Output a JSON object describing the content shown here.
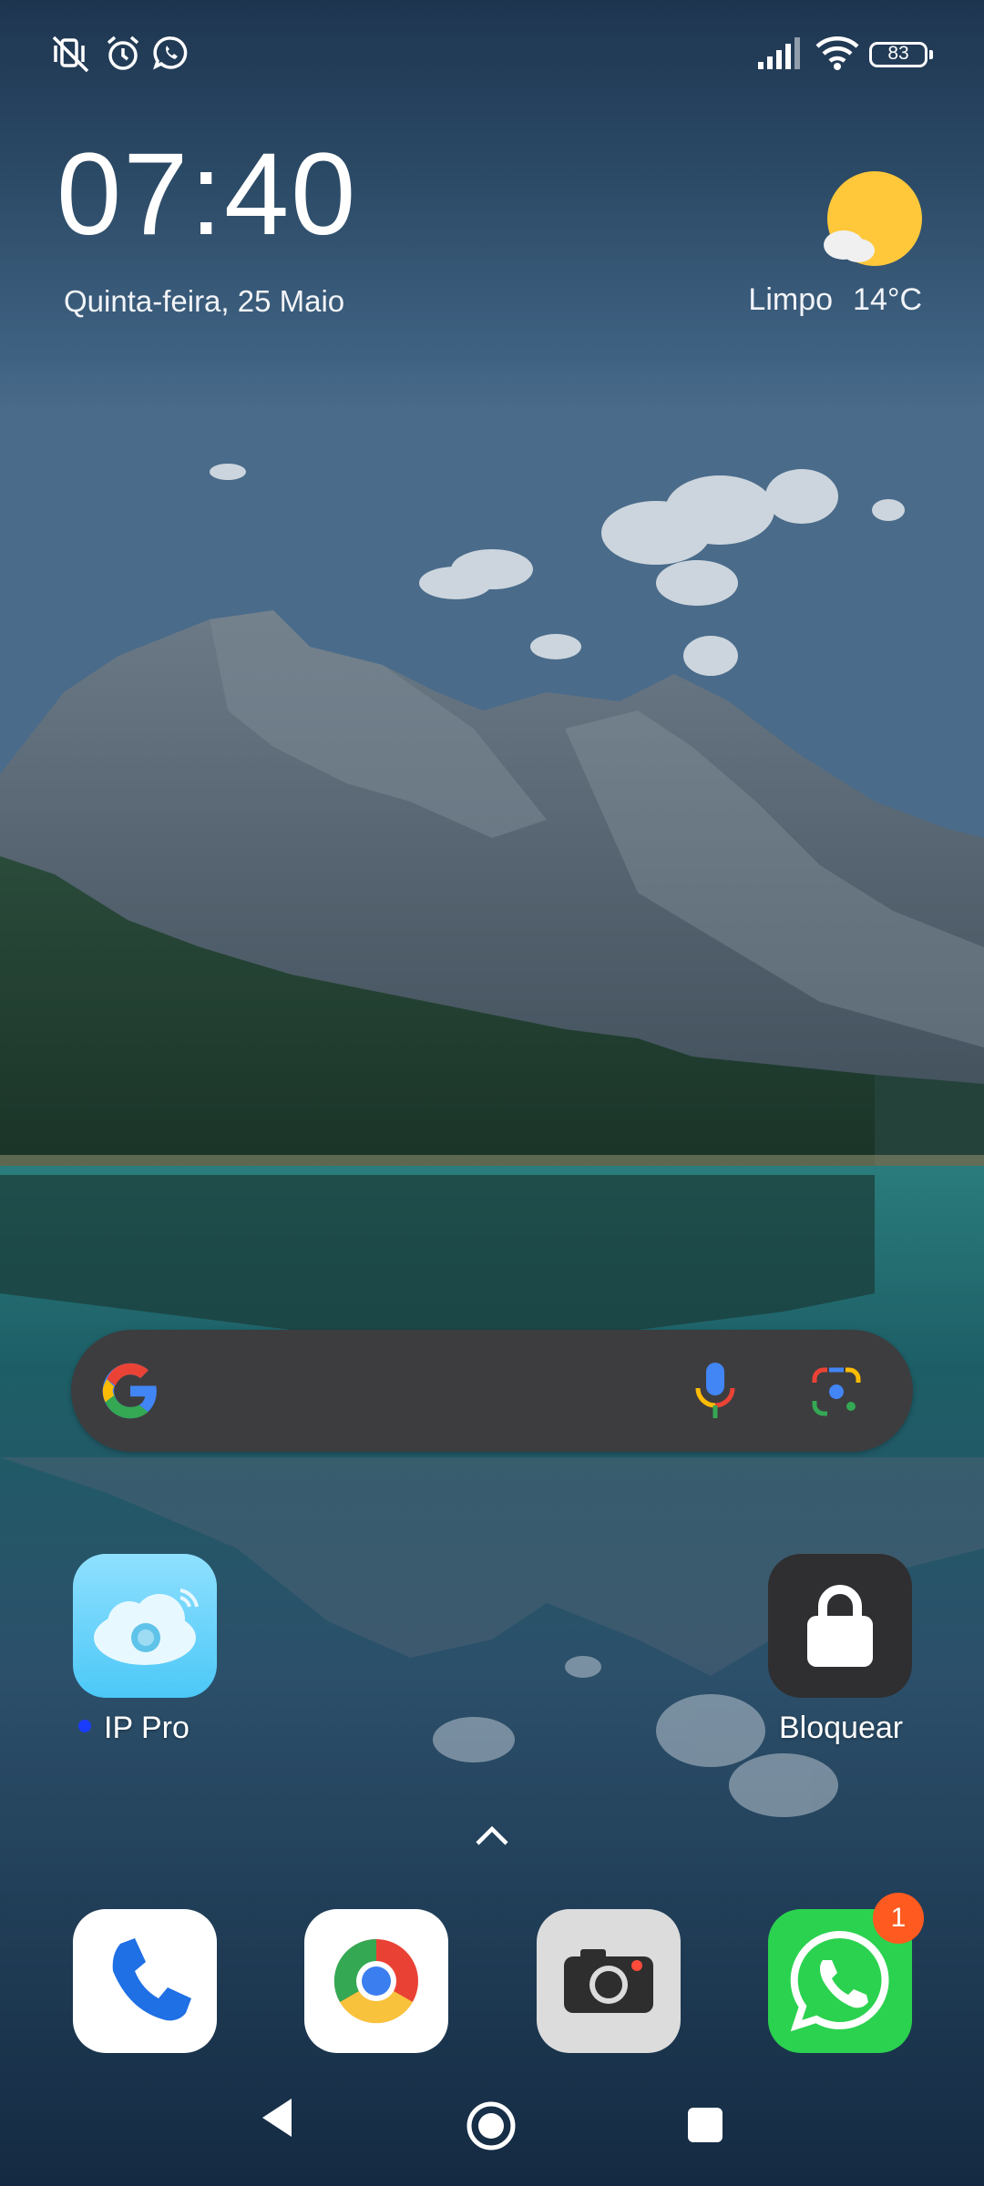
{
  "status_bar": {
    "battery_level": "83",
    "left_icons": [
      "vibrate-off-icon",
      "alarm-icon",
      "whatsapp-notification-icon"
    ],
    "right_icons": [
      "signal-icon",
      "wifi-icon",
      "battery-icon"
    ]
  },
  "clock_widget": {
    "time": "07:40",
    "date": "Quinta-feira, 25 Maio"
  },
  "weather_widget": {
    "condition": "Limpo",
    "temperature": "14°C",
    "icon": "sun-cloud-icon"
  },
  "search_widget": {
    "icons": [
      "google-g-icon",
      "microphone-icon",
      "google-lens-icon"
    ]
  },
  "home_apps": [
    {
      "label": "IP Pro",
      "icon": "cloud-camera-icon",
      "new_dot": true
    },
    {
      "label": "Bloquear",
      "icon": "lock-icon"
    }
  ],
  "dock": [
    {
      "app": "phone",
      "icon": "phone-icon"
    },
    {
      "app": "chrome",
      "icon": "chrome-icon"
    },
    {
      "app": "camera",
      "icon": "camera-icon"
    },
    {
      "app": "whatsapp",
      "icon": "whatsapp-icon",
      "badge": "1"
    }
  ],
  "nav_bar": [
    "back-icon",
    "home-icon",
    "recents-icon"
  ],
  "colors": {
    "sky": "#2c4a66",
    "lake": "#1f6b6e",
    "badge": "#ff5a1f",
    "whatsapp": "#25d366"
  }
}
